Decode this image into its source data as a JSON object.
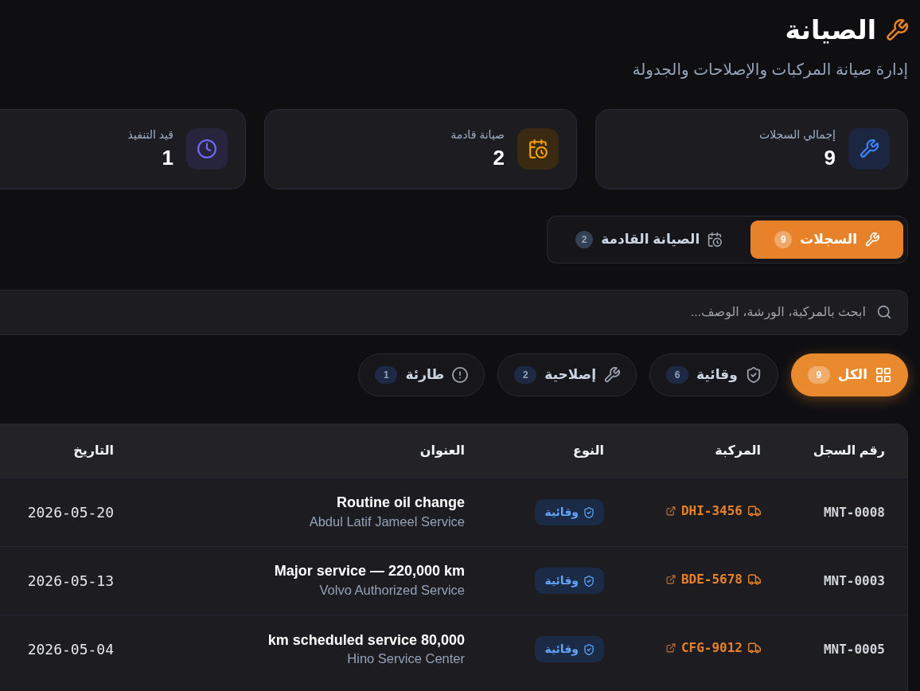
{
  "header": {
    "title": "الصيانة",
    "subtitle": "إدارة صيانة المركبات والإصلاحات والجدولة"
  },
  "stats": [
    {
      "kind": "total",
      "label": "إجمالي السجلات",
      "value": "9"
    },
    {
      "kind": "upcoming",
      "label": "صيانة قادمة",
      "value": "2"
    },
    {
      "kind": "ongoing",
      "label": "قيد التنفيذ",
      "value": "1"
    }
  ],
  "tabs": [
    {
      "kind": "records",
      "label": "السجلات",
      "count": "9",
      "selected": true
    },
    {
      "kind": "upcoming",
      "label": "الصيانة القادمة",
      "count": "2",
      "selected": false
    }
  ],
  "search": {
    "placeholder": "ابحث بالمركبة، الورشة، الوصف..."
  },
  "filters": [
    {
      "kind": "all",
      "label": "الكل",
      "count": "9",
      "selected": true
    },
    {
      "kind": "preventive",
      "label": "وقائية",
      "count": "6",
      "selected": false
    },
    {
      "kind": "corrective",
      "label": "إصلاحية",
      "count": "2",
      "selected": false
    },
    {
      "kind": "emergency",
      "label": "طارئة",
      "count": "1",
      "selected": false
    }
  ],
  "table": {
    "columns": [
      "رقم السجل",
      "المركبة",
      "النوع",
      "العنوان",
      "التاريخ"
    ],
    "rows": [
      {
        "record_no": "MNT-0008",
        "vehicle": "DHI-3456",
        "type": {
          "kind": "preventive",
          "label": "وقائية"
        },
        "title": "Routine oil change",
        "workshop": "Abdul Latif Jameel Service",
        "date": "2026-05-20"
      },
      {
        "record_no": "MNT-0003",
        "vehicle": "BDE-5678",
        "type": {
          "kind": "preventive",
          "label": "وقائية"
        },
        "title": "Major service — 220,000 km",
        "workshop": "Volvo Authorized Service",
        "date": "2026-05-13"
      },
      {
        "record_no": "MNT-0005",
        "vehicle": "CFG-9012",
        "type": {
          "kind": "preventive",
          "label": "وقائية"
        },
        "title": "km scheduled service 80,000",
        "workshop": "Hino Service Center",
        "date": "2026-05-04"
      }
    ]
  }
}
